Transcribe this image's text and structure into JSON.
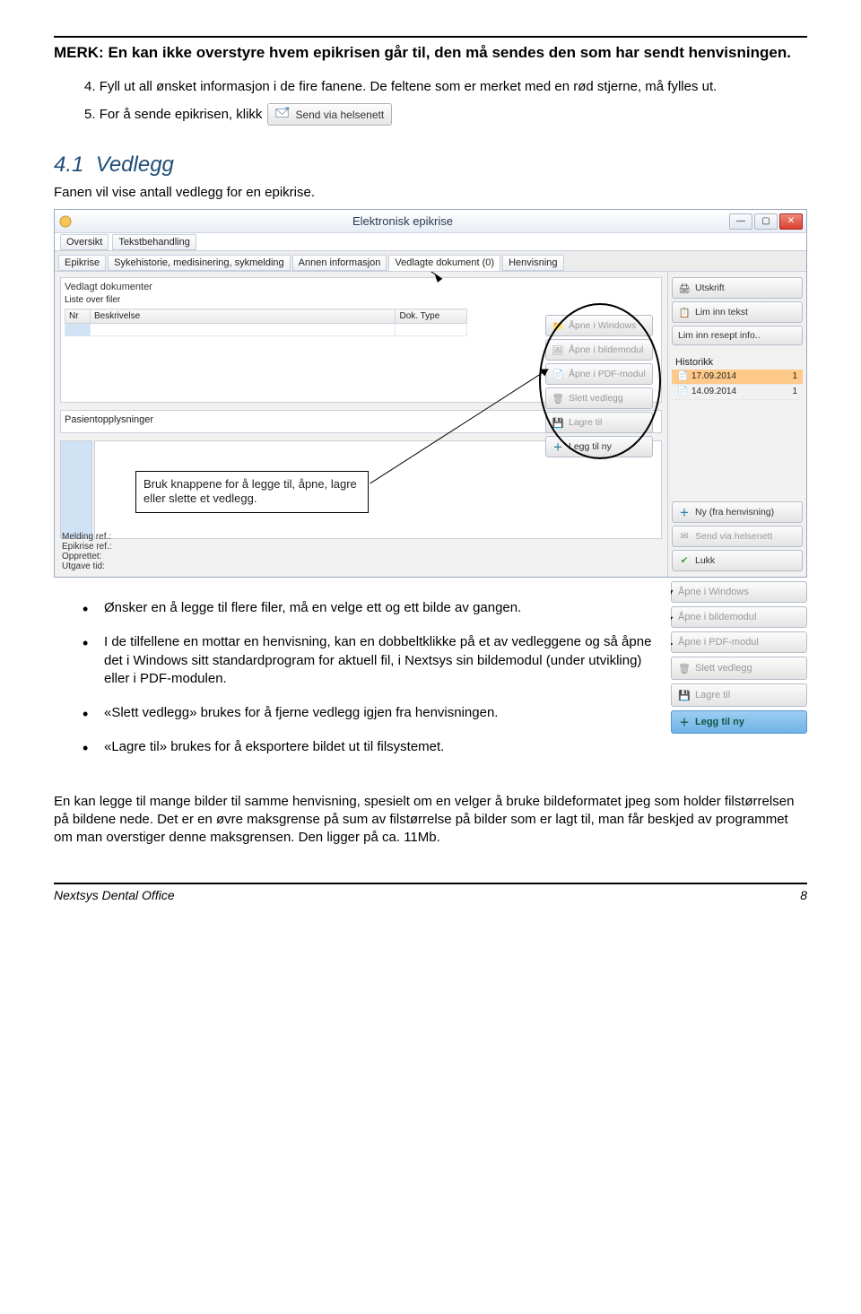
{
  "note_heading": "MERK: En kan ikke overstyre hvem epikrisen går til, den må sendes den som har sendt henvisningen.",
  "steps": {
    "n4": "4.",
    "t4": "Fyll ut all ønsket informasjon i de fire fanene. De feltene som er merket med en rød stjerne, må fylles ut.",
    "n5": "5.",
    "t5": "For å sende epikrisen, klikk",
    "btn5": "Send via helsenett"
  },
  "section": {
    "num": "4.1",
    "title": "Vedlegg",
    "intro": "Fanen vil vise antall vedlegg for en epikrise."
  },
  "win": {
    "title": "Elektronisk epikrise",
    "menu": {
      "oversikt": "Oversikt",
      "tekst": "Tekstbehandling"
    },
    "tabs": {
      "epikrise": "Epikrise",
      "syk": "Sykehistorie, medisinering, sykmelding",
      "annen": "Annen informasjon",
      "vedlagte": "Vedlagte dokument (0)",
      "henvisning": "Henvisning"
    },
    "panel1": {
      "title": "Vedlagt dokumenter",
      "sub": "Liste over filer",
      "col_nr": "Nr",
      "col_besk": "Beskrivelse",
      "col_dok": "Dok. Type"
    },
    "panel2": "Pasientopplysninger",
    "side_attach": {
      "win": "Åpne i Windows",
      "bilde": "Åpne i bildemodul",
      "pdf": "Åpne i PDF-modul",
      "slett": "Slett vedlegg",
      "lagre": "Lagre til",
      "legg": "Legg til ny"
    },
    "right": {
      "utskrift": "Utskrift",
      "liminn": "Lim inn tekst",
      "resept": "Lim inn resept info..",
      "hist": "Historikk",
      "d1": "17.09.2014",
      "c1": "1",
      "d2": "14.09.2014",
      "c2": "1",
      "ny": "Ny (fra henvisning)",
      "send": "Send via helsenett",
      "lukk": "Lukk"
    },
    "meta": {
      "m1": "Melding ref.:",
      "m2": "Epikrise ref.:",
      "m3": "Opprettet:",
      "m4": "Utgave tid:"
    }
  },
  "callout": "Bruk knappene for å legge til, åpne, lagre eller slette et vedlegg.",
  "bullets": {
    "b1": "Ønsker en å legge til flere filer, må en velge ett og ett bilde av gangen.",
    "b2": "I de tilfellene en mottar en henvisning, kan en dobbeltklikke på et av vedleggene og så åpne det i Windows sitt standardprogram for aktuell fil, i Nextsys sin bildemodul (under utvikling) eller i PDF-modulen.",
    "b3": "«Slett vedlegg» brukes for å fjerne vedlegg igjen fra henvisningen.",
    "b4": "«Lagre til» brukes for å eksportere bildet ut til filsystemet."
  },
  "stack": {
    "win": "Åpne i Windows",
    "bilde": "Åpne i bildemodul",
    "pdf": "Åpne i PDF-modul",
    "slett": "Slett vedlegg",
    "lagre": "Lagre til",
    "legg": "Legg til ny"
  },
  "closing": "En kan legge til mange bilder til samme henvisning, spesielt om en velger å bruke bildeformatet jpeg som holder filstørrelsen på bildene nede. Det er en øvre maksgrense på sum av filstørrelse på bilder som er lagt til, man får beskjed av programmet om man overstiger denne maksgrensen. Den ligger på ca. 11Mb.",
  "footer": {
    "left": "Nextsys Dental Office",
    "right": "8"
  }
}
